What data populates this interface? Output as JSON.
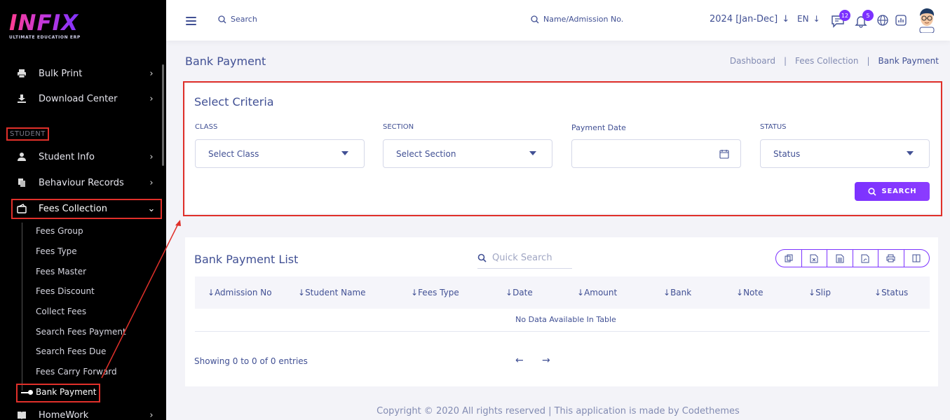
{
  "sidebar": {
    "logo": {
      "main": "INFIX",
      "sub": "ULTIMATE EDUCATION ERP"
    },
    "items_top": [
      {
        "label": "Bulk Print",
        "icon": "printer-icon"
      },
      {
        "label": "Download Center",
        "icon": "download-icon"
      }
    ],
    "section_label": "STUDENT",
    "items_student": [
      {
        "label": "Student Info",
        "icon": "user-icon"
      },
      {
        "label": "Behaviour Records",
        "icon": "document-icon"
      },
      {
        "label": "Fees Collection",
        "icon": "wallet-icon"
      }
    ],
    "fees_sub": [
      "Fees Group",
      "Fees Type",
      "Fees Master",
      "Fees Discount",
      "Collect Fees",
      "Search Fees Payment",
      "Search Fees Due",
      "Fees Carry Forward",
      "Bank Payment"
    ],
    "homework": {
      "label": "HomeWork",
      "icon": "book-icon"
    }
  },
  "topbar": {
    "search_label": "Search",
    "name_search_label": "Name/Admission No.",
    "year": "2024 [Jan-Dec]",
    "lang": "EN",
    "messages_count": "12",
    "notifications_count": "5"
  },
  "page": {
    "title": "Bank Payment",
    "breadcrumb": [
      "Dashboard",
      "Fees Collection",
      "Bank Payment"
    ]
  },
  "criteria": {
    "title": "Select Criteria",
    "class_label": "CLASS",
    "class_placeholder": "Select Class",
    "section_label": "SECTION",
    "section_placeholder": "Select Section",
    "date_label": "Payment Date",
    "status_label": "STATUS",
    "status_placeholder": "Status",
    "search_button": "SEARCH"
  },
  "list": {
    "title": "Bank Payment List",
    "quick_search_placeholder": "Quick Search",
    "columns": [
      "Admission No",
      "Student Name",
      "Fees Type",
      "Date",
      "Amount",
      "Bank",
      "Note",
      "Slip",
      "Status"
    ],
    "no_data": "No Data Available In Table",
    "showing": "Showing 0 to 0 of 0 entries"
  },
  "footer": "Copyright © 2020 All rights reserved | This application is made by Codethemes",
  "colors": {
    "accent": "#7c32ff",
    "highlight_red": "#e0302a",
    "text": "#415094"
  }
}
